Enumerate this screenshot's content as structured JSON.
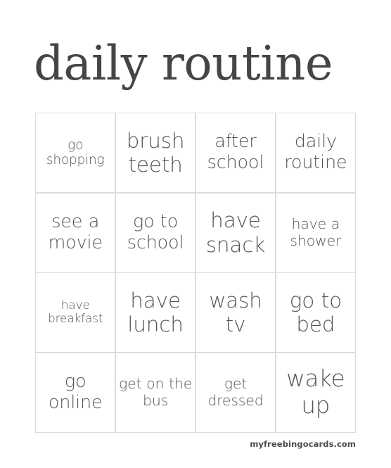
{
  "card": {
    "title": "daily routine",
    "footer": "myfreebingocards.com",
    "colors": {
      "background": "#ffffff",
      "title_text": "#454545",
      "cell_text": "#555555",
      "grid_line": "#dcdcdc",
      "footer_text": "#4a4a4a"
    },
    "grid": {
      "columns": 4,
      "rows": 4,
      "cells": [
        {
          "text": "go shopping",
          "size": "fs-s"
        },
        {
          "text": "brush teeth",
          "size": "fs-l"
        },
        {
          "text": "after school",
          "size": "fs-m"
        },
        {
          "text": "daily routine",
          "size": "fs-m"
        },
        {
          "text": "see a movie",
          "size": "fs-m"
        },
        {
          "text": "go to school",
          "size": "fs-m"
        },
        {
          "text": "have snack",
          "size": "fs-l"
        },
        {
          "text": "have a shower",
          "size": "fs-sm"
        },
        {
          "text": "have breakfast",
          "size": "fs-xs"
        },
        {
          "text": "have lunch",
          "size": "fs-l"
        },
        {
          "text": "wash tv",
          "size": "fs-l"
        },
        {
          "text": "go to bed",
          "size": "fs-l"
        },
        {
          "text": "go online",
          "size": "fs-m"
        },
        {
          "text": "get on the bus",
          "size": "fs-sm"
        },
        {
          "text": "get dressed",
          "size": "fs-sm"
        },
        {
          "text": "wake up",
          "size": "fs-xl"
        }
      ]
    }
  }
}
